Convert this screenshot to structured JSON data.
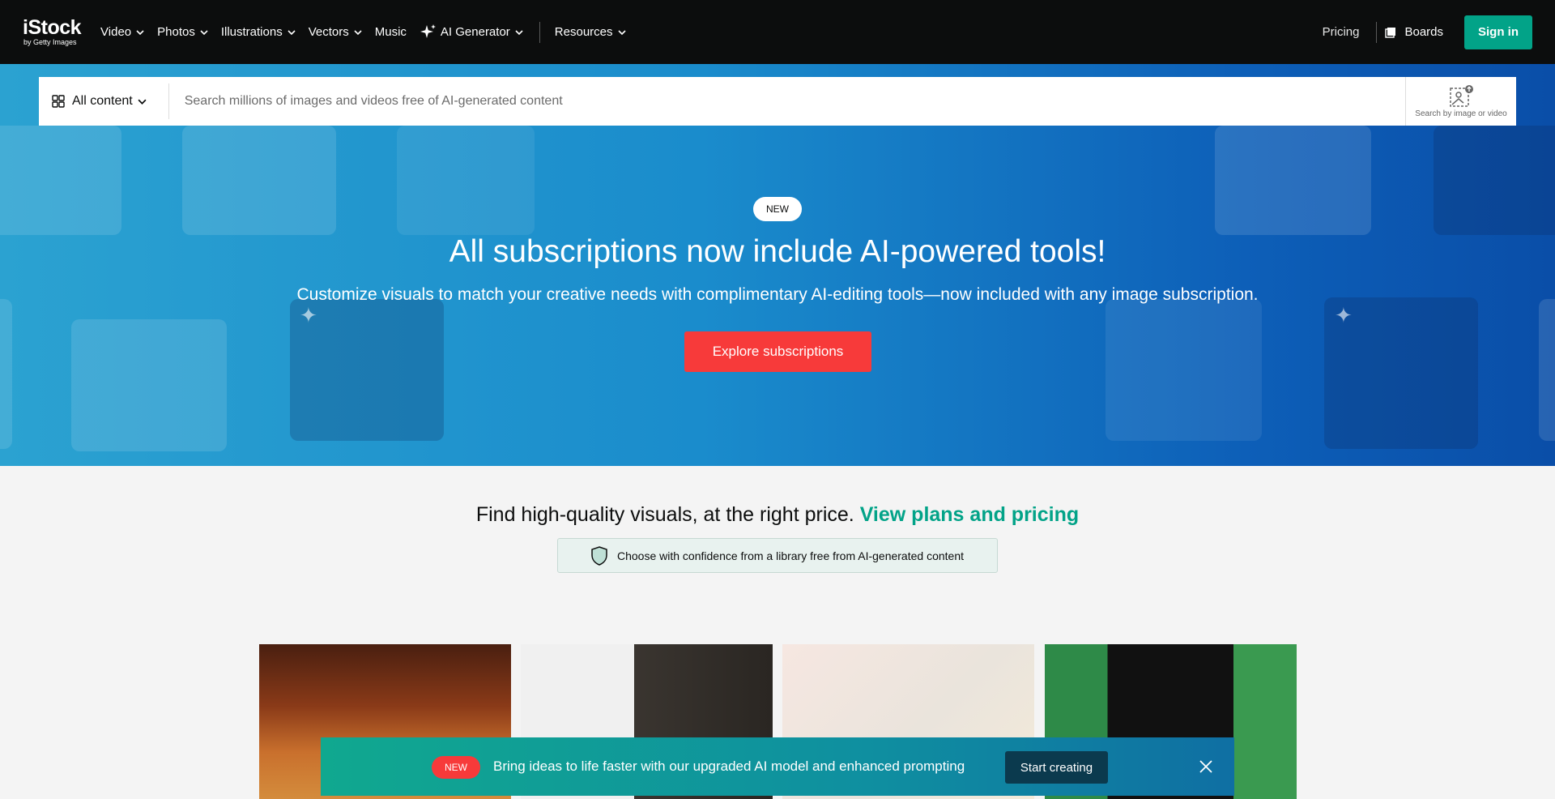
{
  "header": {
    "logo": {
      "brand": "iStock",
      "sub": "by Getty Images"
    },
    "nav": [
      {
        "label": "Video",
        "has_dropdown": true
      },
      {
        "label": "Photos",
        "has_dropdown": true
      },
      {
        "label": "Illustrations",
        "has_dropdown": true
      },
      {
        "label": "Vectors",
        "has_dropdown": true
      },
      {
        "label": "Music",
        "has_dropdown": false
      },
      {
        "label": "AI Generator",
        "has_dropdown": true,
        "icon": "sparkle-icon"
      },
      {
        "label": "Resources",
        "has_dropdown": true
      }
    ],
    "pricing_label": "Pricing",
    "boards_label": "Boards",
    "signin_label": "Sign in"
  },
  "search": {
    "filter_label": "All content",
    "placeholder": "Search millions of images and videos free of AI-generated content",
    "image_search_label": "Search by image or video"
  },
  "hero": {
    "badge": "NEW",
    "title": "All subscriptions now include AI-powered tools!",
    "subtitle": "Customize visuals to match your creative needs with complimentary AI-editing tools—now included with any image subscription.",
    "cta_label": "Explore subscriptions"
  },
  "pricing": {
    "text": "Find high-quality visuals, at the right price.",
    "link": "View plans and pricing",
    "confidence_text": "Choose with confidence from a library free from AI-generated content"
  },
  "banner": {
    "badge": "NEW",
    "text": "Bring ideas to life faster with our upgraded AI model and enhanced prompting",
    "button_label": "Start creating"
  },
  "colors": {
    "accent": "#02a388",
    "cta": "#f73a3a",
    "nav_bg": "#0c0d0d"
  }
}
